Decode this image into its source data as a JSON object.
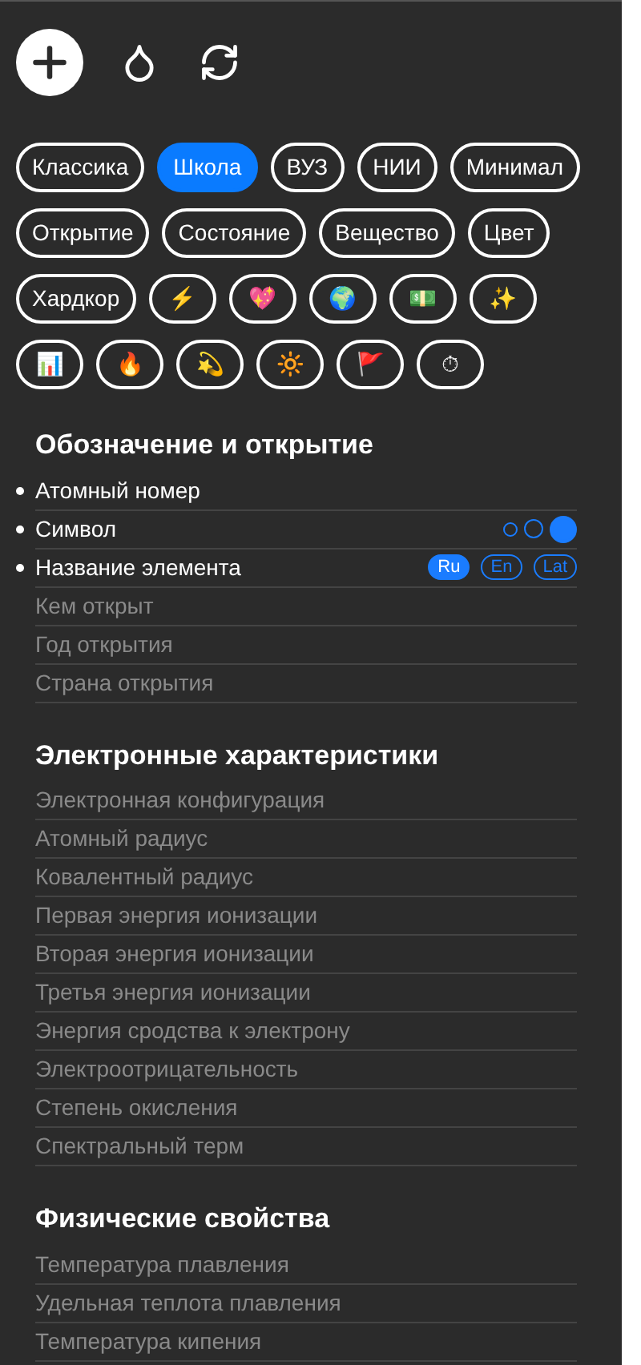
{
  "presets": [
    {
      "label": "Классика",
      "selected": false
    },
    {
      "label": "Школа",
      "selected": true
    },
    {
      "label": "ВУЗ",
      "selected": false
    },
    {
      "label": "НИИ",
      "selected": false
    },
    {
      "label": "Минимал",
      "selected": false
    },
    {
      "label": "Открытие",
      "selected": false
    },
    {
      "label": "Состояние",
      "selected": false
    },
    {
      "label": "Вещество",
      "selected": false
    },
    {
      "label": "Цвет",
      "selected": false
    },
    {
      "label": "Хардкор",
      "selected": false
    },
    {
      "label": "⚡",
      "selected": false
    },
    {
      "label": "💖",
      "selected": false
    },
    {
      "label": "🌍",
      "selected": false
    },
    {
      "label": "💵",
      "selected": false
    },
    {
      "label": "✨",
      "selected": false
    },
    {
      "label": "📊",
      "selected": false
    },
    {
      "label": "🔥",
      "selected": false
    },
    {
      "label": "💫",
      "selected": false
    },
    {
      "label": "🔆",
      "selected": false
    },
    {
      "label": "🚩",
      "selected": false
    },
    {
      "label": "⏱",
      "selected": false
    }
  ],
  "sections": [
    {
      "title": "Обозначение и открытие",
      "items": [
        {
          "label": "Атомный номер",
          "enabled": true
        },
        {
          "label": "Символ",
          "enabled": true,
          "kind": "size",
          "options": [
            {
              "selected": false
            },
            {
              "selected": false
            },
            {
              "selected": true
            }
          ]
        },
        {
          "label": "Название элемента",
          "enabled": true,
          "kind": "lang",
          "options": [
            {
              "label": "Ru",
              "selected": true
            },
            {
              "label": "En",
              "selected": false
            },
            {
              "label": "Lat",
              "selected": false
            }
          ]
        },
        {
          "label": "Кем открыт",
          "enabled": false
        },
        {
          "label": "Год открытия",
          "enabled": false
        },
        {
          "label": "Страна открытия",
          "enabled": false
        }
      ]
    },
    {
      "title": "Электронные характеристики",
      "items": [
        {
          "label": "Электронная конфигурация",
          "enabled": false
        },
        {
          "label": "Атомный радиус",
          "enabled": false
        },
        {
          "label": "Ковалентный радиус",
          "enabled": false
        },
        {
          "label": "Первая энергия ионизации",
          "enabled": false
        },
        {
          "label": "Вторая энергия ионизации",
          "enabled": false
        },
        {
          "label": "Третья энергия ионизации",
          "enabled": false
        },
        {
          "label": "Энергия сродства к электрону",
          "enabled": false
        },
        {
          "label": "Электроотрицательность",
          "enabled": false
        },
        {
          "label": "Степень окисления",
          "enabled": false
        },
        {
          "label": "Спектральный терм",
          "enabled": false
        }
      ]
    },
    {
      "title": "Физические свойства",
      "items": [
        {
          "label": "Температура плавления",
          "enabled": false
        },
        {
          "label": "Удельная теплота плавления",
          "enabled": false
        },
        {
          "label": "Температура кипения",
          "enabled": false
        }
      ]
    }
  ]
}
